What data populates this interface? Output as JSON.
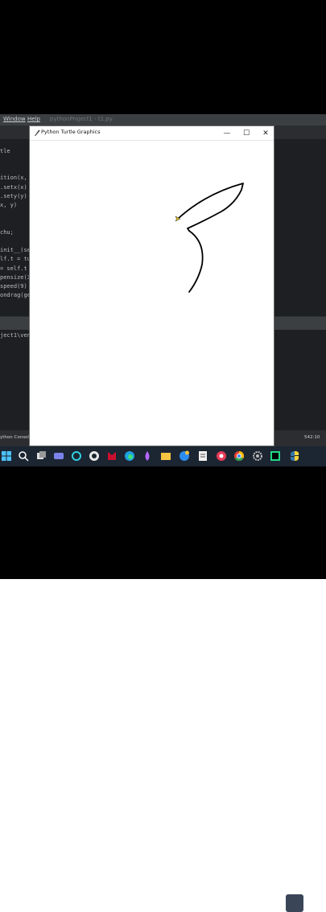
{
  "ide": {
    "menu": [
      "Window",
      "Help"
    ],
    "window_title": "pythonProject1 - t1.py",
    "code_lines": [
      "tle",
      "",
      "",
      "ition(x,",
      ".setx(x)",
      ".sety(y)",
      "x, y)",
      "",
      "",
      "chu;",
      "",
      "init__(se",
      "lf.t = tu",
      "= self.t",
      "pensize(3",
      "speed(9)",
      "ondrag(ge"
    ],
    "run_output": "ject1\\ven",
    "status_left": "ython Console",
    "status_right": "542:10"
  },
  "turtle_window": {
    "title": "Python Turtle Graphics",
    "minimize_glyph": "—",
    "maximize_glyph": "☐",
    "close_glyph": "✕"
  },
  "taskbar": {
    "icons": [
      "windows-start-icon",
      "search-icon",
      "task-view-icon",
      "widgets-icon",
      "teams-icon",
      "cortana-icon",
      "steam-icon",
      "mcafee-icon",
      "edge-icon",
      "edge-beta-icon",
      "paint-icon",
      "file-explorer-icon",
      "settings-edge-icon",
      "notepad-icon",
      "screen-recorder-icon",
      "chrome-icon",
      "settings-icon",
      "pycharm-icon",
      "python-icon"
    ]
  }
}
